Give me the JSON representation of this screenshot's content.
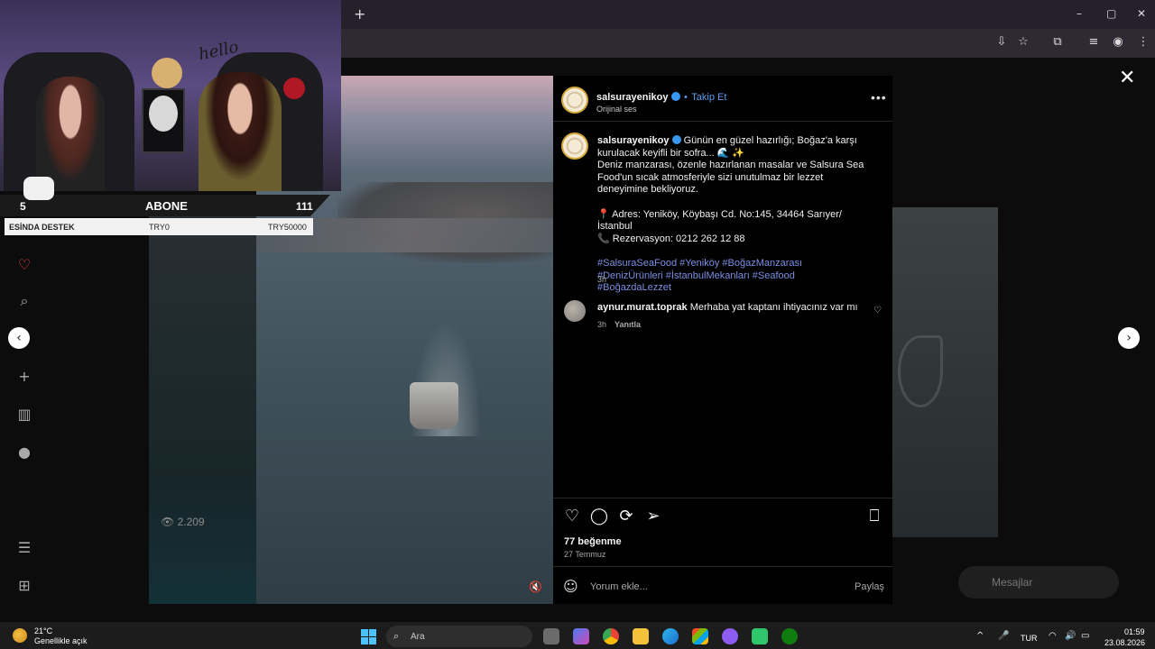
{
  "browser": {
    "new_tab_symbol": "+",
    "window_controls": [
      "–",
      "▢",
      "✕"
    ],
    "toolbar_icons": [
      "install-icon",
      "star-icon",
      "extensions-icon",
      "media-icon",
      "profile-icon",
      "menu-icon"
    ]
  },
  "webcam": {
    "hello_text": "hello",
    "stat_left": "5",
    "stat_label": "ABONE",
    "stat_right": "111",
    "donate_label": "ESİNDA DESTEK",
    "donate_amount_current": "TRY0",
    "donate_amount_goal": "TRY50000"
  },
  "background": {
    "left_views": "2.209",
    "messages_label": "Mesajlar"
  },
  "post": {
    "header": {
      "username": "salsurayenikoy",
      "separator": "•",
      "follow_label": "Takip Et",
      "audio": "Orijinal ses"
    },
    "caption": {
      "username": "salsurayenikoy",
      "line1": "Günün en güzel hazırlığı; Boğaz'a karşı kurulacak keyifli bir sofra... 🌊 ✨",
      "line2": "Deniz manzarası, özenle hazırlanan masalar ve Salsura Sea Food'un sıcak atmosferiyle sizi unutulmaz bir lezzet deneyimine bekliyoruz.",
      "address": "📍 Adres: Yeniköy, Köybaşı Cd. No:145, 34464 Sarıyer/İstanbul",
      "phone": "📞 Rezervasyon: 0212 262 12 88",
      "tags": "#SalsuraSeaFood #Yeniköy #BoğazManzarası #DenizÜrünleri #İstanbulMekanları #Seafood #BoğazdaLezzet",
      "time": "3h"
    },
    "comment": {
      "username": "aynur.murat.toprak",
      "text": "Merhaba yat kaptanı ihtiyacınız var mı",
      "time": "3h",
      "reply_label": "Yanıtla"
    },
    "likes": "77 beğenme",
    "date": "27 Temmuz",
    "comment_placeholder": "Yorum ekle...",
    "share_label": "Paylaş"
  },
  "taskbar": {
    "temperature": "21°C",
    "weather": "Genellikle açık",
    "search_label": "Ara",
    "language": "TUR",
    "time": "01:59",
    "date": "23.08.2026"
  }
}
